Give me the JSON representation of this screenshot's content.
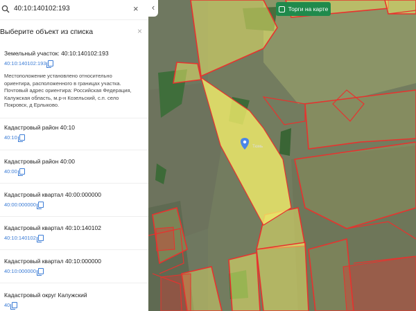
{
  "search": {
    "query": "40:10:140102:193",
    "clear_label": "×"
  },
  "panel": {
    "title": "Выберите объект из списка",
    "close_label": "×",
    "items": [
      {
        "title": "Земельный участок: 40:10:140102:193",
        "number": "40:10:140102:193",
        "address": "Местоположение установлено относительно ориентира, расположенного в границах участка. Почтовый адрес ориентира: Российская Федерация, Калужская область, м.р-н Козельский, с.п. село Покровск, д Ерлыково."
      },
      {
        "title": "Кадастровый район 40:10",
        "number": "40:10"
      },
      {
        "title": "Кадастровый район 40:00",
        "number": "40:00"
      },
      {
        "title": "Кадастровый квартал 40:00:000000",
        "number": "40:00:000000"
      },
      {
        "title": "Кадастровый квартал 40:10:140102",
        "number": "40:10:140102"
      },
      {
        "title": "Кадастровый квартал 40:10:000000",
        "number": "40:10:000000"
      },
      {
        "title": "Кадастровый округ Калужский",
        "number": "40"
      }
    ]
  },
  "map": {
    "collapse_label": "‹",
    "torgi_label": "Торги на карте",
    "marker_label": "Тюмь",
    "colors": {
      "accent": "#1f8a4c",
      "parcel_fill": "#f2ee6a",
      "parcel_border": "#e8322e",
      "link": "#3a7bd5",
      "marker": "#4a86e8"
    }
  }
}
